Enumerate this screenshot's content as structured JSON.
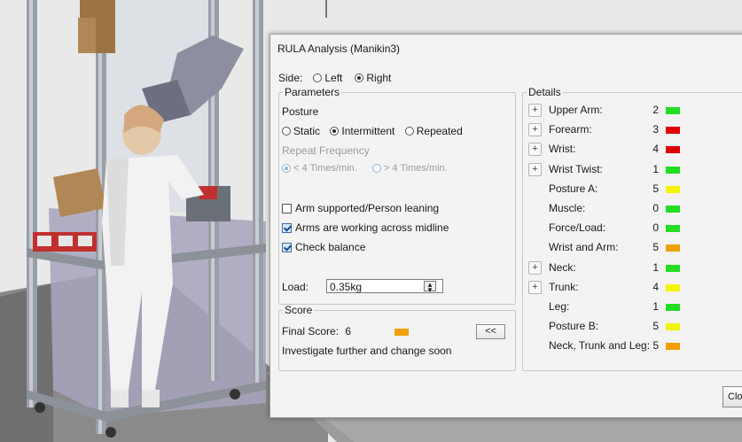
{
  "dialog": {
    "title": "RULA Analysis (Manikin3)",
    "side": {
      "label": "Side:",
      "options": [
        "Left",
        "Right"
      ],
      "selected": "Right"
    },
    "parameters": {
      "legend": "Parameters",
      "posture_label": "Posture",
      "posture_options": [
        "Static",
        "Intermittent",
        "Repeated"
      ],
      "posture_selected": "Intermittent",
      "repeat_label": "Repeat Frequency",
      "repeat_options": [
        "< 4 Times/min.",
        "> 4 Times/min."
      ],
      "repeat_selected": "< 4 Times/min.",
      "checkboxes": [
        {
          "label": "Arm supported/Person leaning",
          "checked": false
        },
        {
          "label": "Arms are working across midline",
          "checked": true
        },
        {
          "label": "Check balance",
          "checked": true
        }
      ],
      "load_label": "Load:",
      "load_value": "0.35kg"
    },
    "score": {
      "legend": "Score",
      "final_label": "Final Score:",
      "final_value": "6",
      "final_color": "#f0a000",
      "message": "Investigate further and change soon",
      "collapse_label": "<<"
    },
    "details": {
      "legend": "Details",
      "rows": [
        {
          "label": "Upper Arm:",
          "value": "2",
          "color": "#22dd22",
          "expandable": true
        },
        {
          "label": "Forearm:",
          "value": "3",
          "color": "#e00000",
          "expandable": true
        },
        {
          "label": "Wrist:",
          "value": "4",
          "color": "#e00000",
          "expandable": true
        },
        {
          "label": "Wrist Twist:",
          "value": "1",
          "color": "#22dd22",
          "expandable": true
        },
        {
          "label": "Posture A:",
          "value": "5",
          "color": "#f4f400",
          "expandable": false
        },
        {
          "label": "Muscle:",
          "value": "0",
          "color": "#22dd22",
          "expandable": false
        },
        {
          "label": "Force/Load:",
          "value": "0",
          "color": "#22dd22",
          "expandable": false
        },
        {
          "label": "Wrist and Arm:",
          "value": "5",
          "color": "#f0a000",
          "expandable": false
        },
        {
          "label": "Neck:",
          "value": "1",
          "color": "#22dd22",
          "expandable": true
        },
        {
          "label": "Trunk:",
          "value": "4",
          "color": "#f4f400",
          "expandable": true
        },
        {
          "label": "Leg:",
          "value": "1",
          "color": "#22dd22",
          "expandable": false
        },
        {
          "label": "Posture B:",
          "value": "5",
          "color": "#f4f400",
          "expandable": false
        },
        {
          "label": "Neck, Trunk and Leg:",
          "value": "5",
          "color": "#f0a000",
          "expandable": false
        }
      ],
      "expand_symbol": "+"
    },
    "close_label": "Close"
  }
}
